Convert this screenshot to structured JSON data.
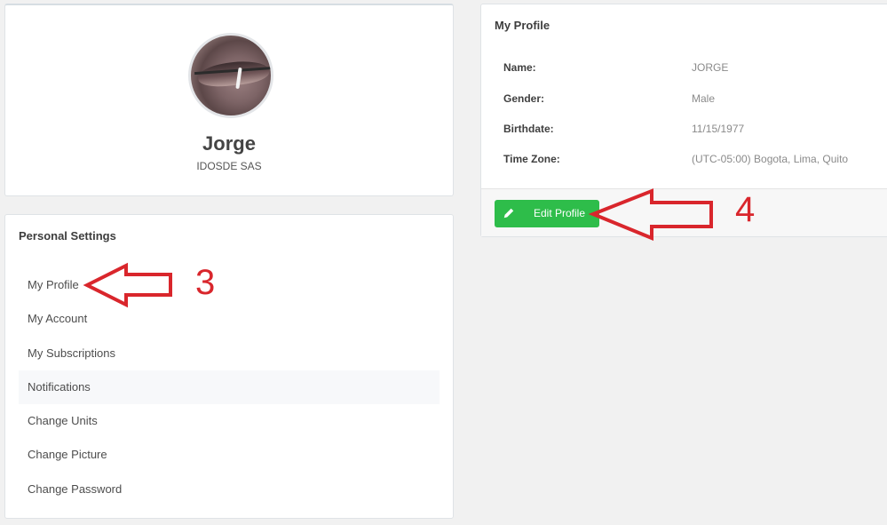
{
  "profile_card": {
    "name": "Jorge",
    "company": "IDOSDE SAS"
  },
  "settings": {
    "title": "Personal Settings",
    "items": [
      {
        "label": "My Profile"
      },
      {
        "label": "My Account"
      },
      {
        "label": "My Subscriptions"
      },
      {
        "label": "Notifications"
      },
      {
        "label": "Change Units"
      },
      {
        "label": "Change Picture"
      },
      {
        "label": "Change Password"
      }
    ]
  },
  "my_profile": {
    "title": "My Profile",
    "fields": [
      {
        "label": "Name:",
        "value": "JORGE"
      },
      {
        "label": "Gender:",
        "value": "Male"
      },
      {
        "label": "Birthdate:",
        "value": "11/15/1977"
      },
      {
        "label": "Time Zone:",
        "value": "(UTC-05:00) Bogota, Lima, Quito"
      }
    ],
    "edit_button": "Edit Profile"
  },
  "annotations": {
    "step_a": "3",
    "step_b": "4"
  },
  "colors": {
    "accent_green": "#2ebd4a",
    "annotation_red": "#d9262c",
    "page_bg": "#f1f1f1"
  },
  "icons": {
    "edit_button_icon": "pencil-icon"
  }
}
